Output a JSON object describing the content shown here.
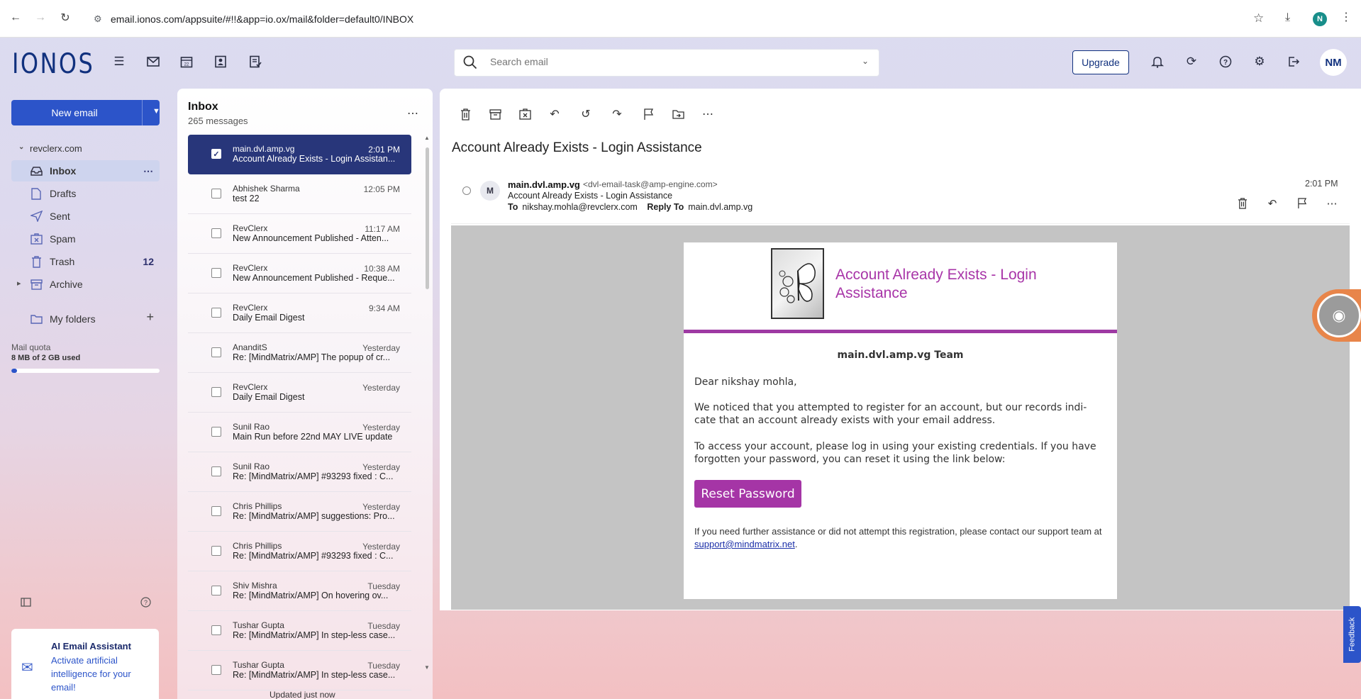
{
  "browser": {
    "url": "email.ionos.com/appsuite/#!!&app=io.ox/mail&folder=default0/INBOX",
    "profile_initial": "N"
  },
  "header": {
    "logo": "IONOS",
    "search_placeholder": "Search email",
    "upgrade_label": "Upgrade",
    "avatar_initials": "NM"
  },
  "sidebar": {
    "new_email_label": "New email",
    "account": "revclerx.com",
    "folders": [
      {
        "label": "Inbox",
        "count": ""
      },
      {
        "label": "Drafts",
        "count": ""
      },
      {
        "label": "Sent",
        "count": ""
      },
      {
        "label": "Spam",
        "count": ""
      },
      {
        "label": "Trash",
        "count": "12"
      },
      {
        "label": "Archive",
        "count": ""
      }
    ],
    "my_folders_label": "My folders",
    "quota_label": "Mail quota",
    "quota_value": "8 MB of 2 GB used",
    "quota_fraction": 0.004,
    "ai_title": "AI Email Assistant",
    "ai_desc": "Activate artificial intelligence for your email!"
  },
  "mail_list": {
    "title": "Inbox",
    "count": "265 messages",
    "updated": "Updated just now",
    "items": [
      {
        "from": "main.dvl.amp.vg",
        "subject": "Account Already Exists - Login Assistan...",
        "time": "2:01 PM"
      },
      {
        "from": "Abhishek Sharma",
        "subject": "test 22",
        "time": "12:05 PM"
      },
      {
        "from": "RevClerx",
        "subject": "New Announcement Published - Atten...",
        "time": "11:17 AM"
      },
      {
        "from": "RevClerx",
        "subject": "New Announcement Published - Reque...",
        "time": "10:38 AM"
      },
      {
        "from": "RevClerx",
        "subject": "Daily Email Digest",
        "time": "9:34 AM"
      },
      {
        "from": "AnanditS",
        "subject": "Re: [MindMatrix/AMP] The popup of cr...",
        "time": "Yesterday"
      },
      {
        "from": "RevClerx",
        "subject": "Daily Email Digest",
        "time": "Yesterday"
      },
      {
        "from": "Sunil Rao",
        "subject": "Main Run before 22nd MAY LIVE update",
        "time": "Yesterday"
      },
      {
        "from": "Sunil Rao",
        "subject": "Re: [MindMatrix/AMP] #93293 fixed : C...",
        "time": "Yesterday"
      },
      {
        "from": "Chris Phillips",
        "subject": "Re: [MindMatrix/AMP] suggestions: Pro...",
        "time": "Yesterday"
      },
      {
        "from": "Chris Phillips",
        "subject": "Re: [MindMatrix/AMP] #93293 fixed : C...",
        "time": "Yesterday"
      },
      {
        "from": "Shiv Mishra",
        "subject": "Re: [MindMatrix/AMP] On hovering ov...",
        "time": "Tuesday"
      },
      {
        "from": "Tushar Gupta",
        "subject": "Re: [MindMatrix/AMP] In step-less case...",
        "time": "Tuesday"
      },
      {
        "from": "Tushar Gupta",
        "subject": "Re: [MindMatrix/AMP] In step-less case...",
        "time": "Tuesday"
      }
    ]
  },
  "reader": {
    "subject": "Account Already Exists - Login Assistance",
    "sender_initial": "M",
    "from_name": "main.dvl.amp.vg",
    "from_addr": "<dvl-email-task@amp-engine.com>",
    "sub_line": "Account Already Exists - Login Assistance",
    "to_label": "To",
    "to_value": "nikshay.mohla@revclerx.com",
    "reply_to_label": "Reply To",
    "reply_to_value": "main.dvl.amp.vg",
    "time": "2:01 PM"
  },
  "email_body": {
    "headline": "Account Already Exists - Login Assistance",
    "team": "main.dvl.amp.vg Team",
    "greeting": "Dear nikshay mohla,",
    "p1": "We noticed that you attempted to register for an account, but our records indi-cate that an account already exists with your email address.",
    "p2": "To access your account, please log in using your existing credentials. If you have forgotten your password, you can reset it using the link below:",
    "button": "Reset Password",
    "footer_text": "If you need further assistance or did not attempt this registration, please contact our support team at",
    "support_email": "support@mindmatrix.net",
    "footer_end": "."
  },
  "widgets": {
    "feedback_label": "Feedback"
  },
  "colors": {
    "brand": "#11317e",
    "primary": "#2c54c9",
    "selected_row": "#28367a",
    "email_accent": "#a535a6"
  }
}
